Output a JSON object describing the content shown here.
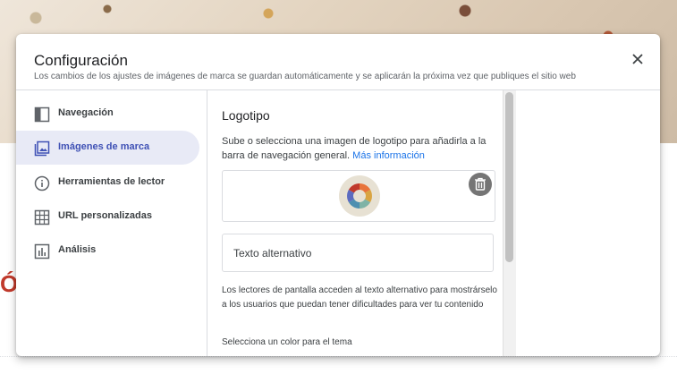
{
  "background": {
    "heading_fragment": "Ó"
  },
  "dialog": {
    "title": "Configuración",
    "subtitle": "Los cambios de los ajustes de imágenes de marca se guardan automáticamente y se aplicarán la próxima vez que publiques el sitio web",
    "close_icon": "close-icon"
  },
  "sidebar": {
    "items": [
      {
        "label": "Navegación",
        "icon": "navigation-layout-icon",
        "active": false
      },
      {
        "label": "Imágenes de marca",
        "icon": "image-icon",
        "active": true
      },
      {
        "label": "Herramientas de lector",
        "icon": "info-icon",
        "active": false
      },
      {
        "label": "URL personalizadas",
        "icon": "table-grid-icon",
        "active": false
      },
      {
        "label": "Análisis",
        "icon": "bar-chart-icon",
        "active": false
      }
    ]
  },
  "content": {
    "section_title": "Logotipo",
    "description": "Sube o selecciona una imagen de logotipo para añadirla a la barra de navegación general.",
    "more_info_link": "Más información",
    "alt_text_placeholder": "Texto alternativo",
    "alt_text_help": "Los lectores de pantalla acceden al texto alternativo para mostrárselo a los usuarios que puedan tener dificultades para ver tu contenido",
    "theme_color_label": "Selecciona un color para el tema"
  },
  "colors": {
    "active_bg": "#e8eaf6",
    "active_text": "#3f51b5",
    "link": "#1a73e8"
  }
}
